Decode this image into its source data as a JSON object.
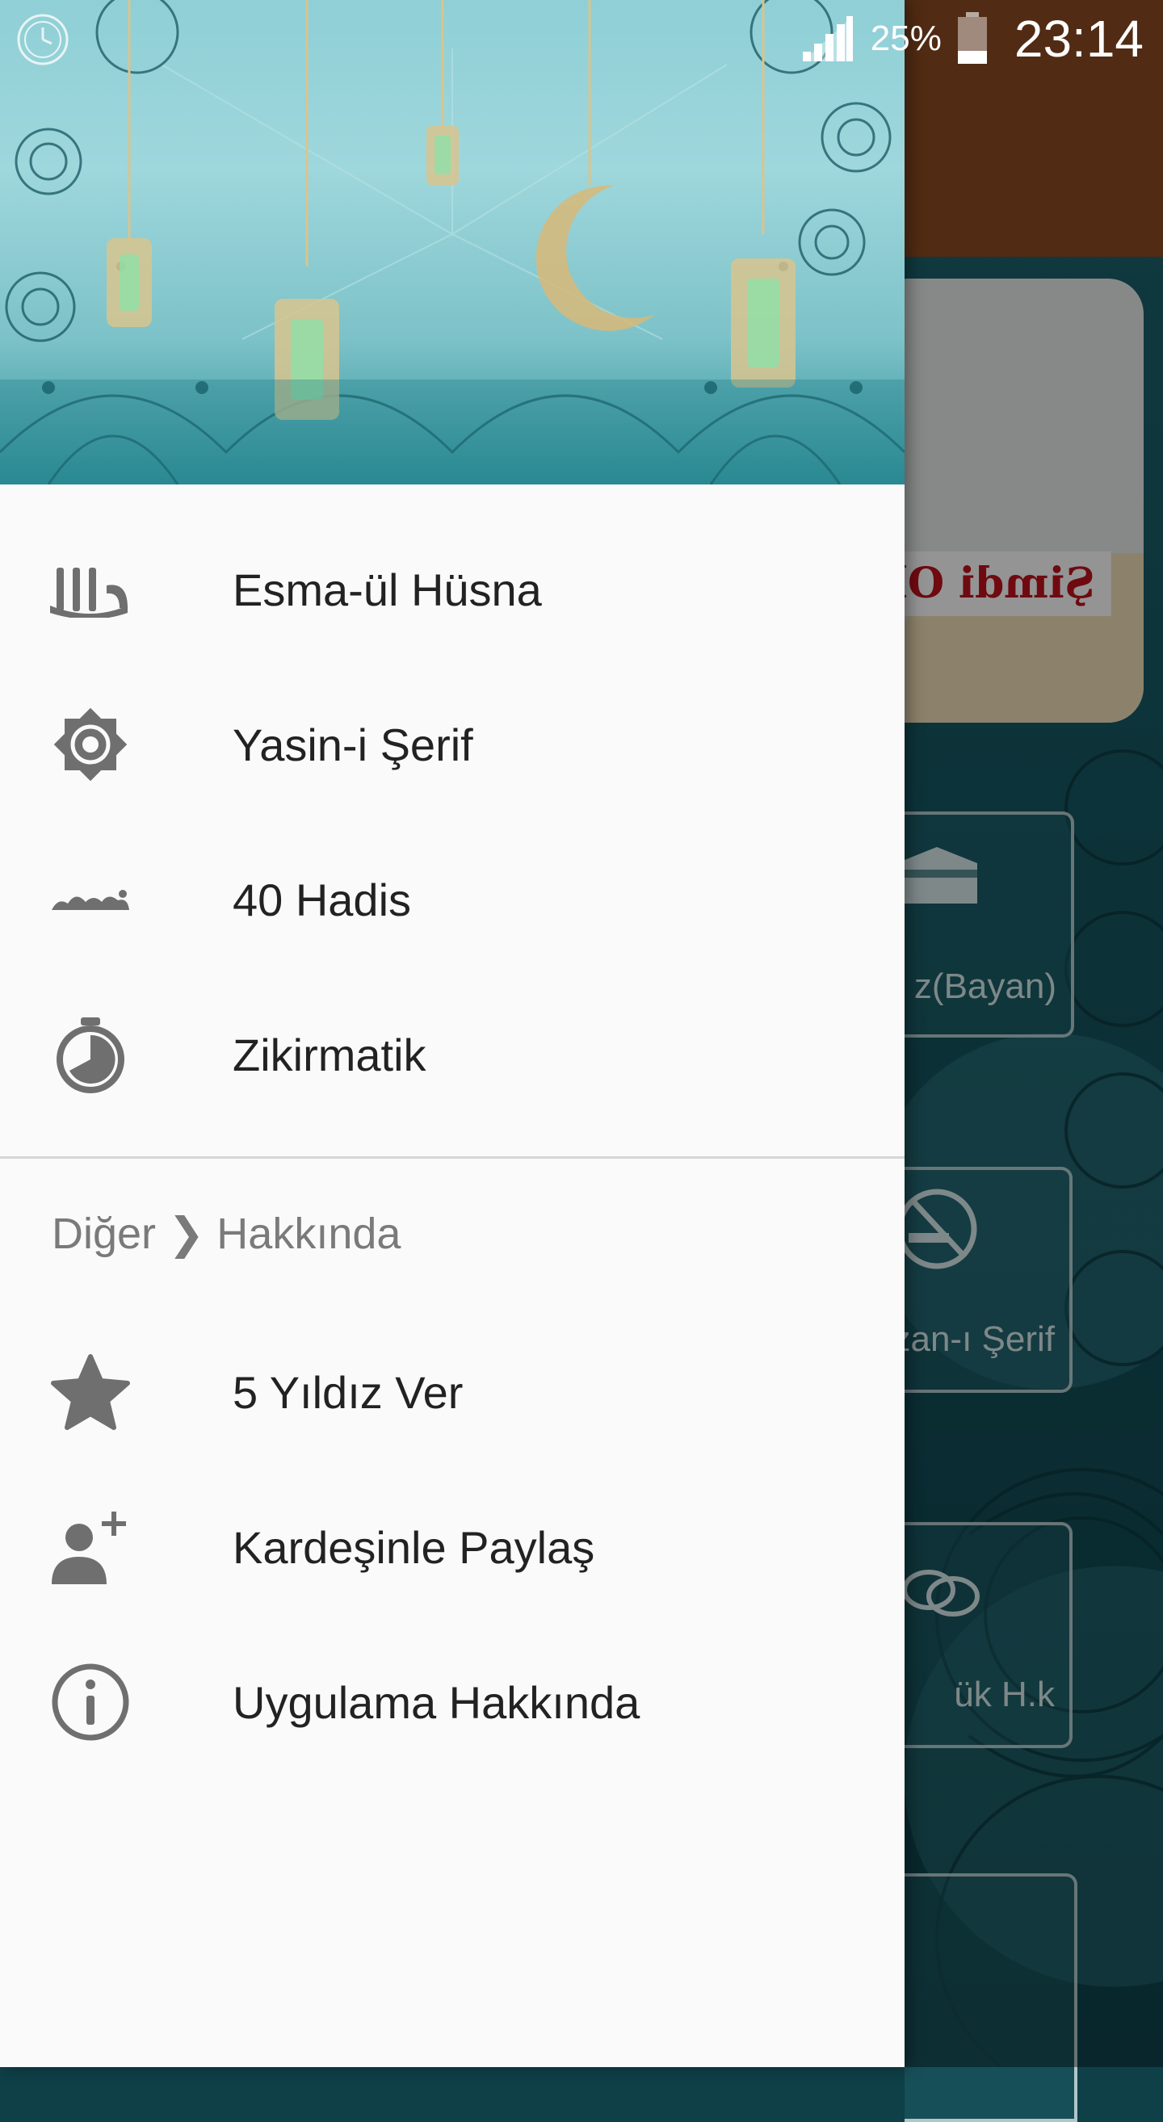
{
  "status_bar": {
    "battery_percent": "25%",
    "time": "23:14"
  },
  "drawer": {
    "menu": [
      {
        "label": "Esma-ül Hüsna",
        "icon": "allah-calligraphy-icon"
      },
      {
        "label": "Yasin-i Şerif",
        "icon": "rub-el-hizb-icon"
      },
      {
        "label": "40 Hadis",
        "icon": "muhammad-calligraphy-icon"
      },
      {
        "label": "Zikirmatik",
        "icon": "stopwatch-icon"
      }
    ],
    "section_title": "Diğer ❯ Hakkında",
    "other": [
      {
        "label": "5 Yıldız Ver",
        "icon": "star-icon"
      },
      {
        "label": "Kardeşinle Paylaş",
        "icon": "add-person-icon"
      },
      {
        "label": "Uygulama Hakkında",
        "icon": "info-icon"
      }
    ]
  },
  "background_app": {
    "hero_label": "Şimdi Oku",
    "tiles": [
      {
        "label": "z(Bayan)"
      },
      {
        "label": "zan-ı Şerif"
      },
      {
        "label": "ük H.k"
      }
    ]
  },
  "colors": {
    "toolbar": "#8c4a22",
    "drawer_bg": "#fafafa",
    "icon_gray": "#6f6f6f",
    "text": "#222222",
    "section_text": "#7a7a7a"
  }
}
